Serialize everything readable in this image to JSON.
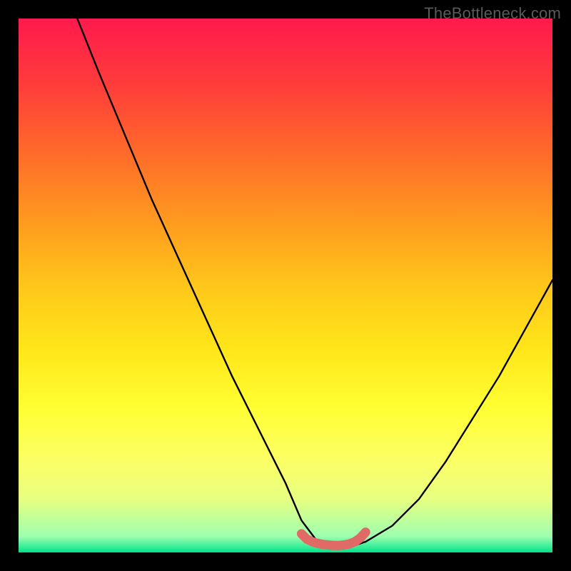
{
  "watermark": "TheBottleneck.com",
  "chart_data": {
    "type": "line",
    "title": "",
    "xlabel": "",
    "ylabel": "",
    "xlim": [
      0,
      100
    ],
    "ylim": [
      0,
      100
    ],
    "series": [
      {
        "name": "bottleneck-curve",
        "x": [
          11,
          15,
          20,
          25,
          30,
          35,
          40,
          45,
          50,
          53,
          56,
          58,
          60,
          62,
          65,
          70,
          75,
          80,
          85,
          90,
          95,
          100
        ],
        "y": [
          100,
          90,
          78,
          66,
          55,
          44,
          33,
          23,
          13,
          6,
          2,
          1,
          1,
          1,
          2,
          5,
          10,
          17,
          25,
          33,
          42,
          51
        ]
      },
      {
        "name": "optimal-zone-marker",
        "x": [
          53,
          54,
          55,
          56,
          57,
          58,
          59,
          60,
          61,
          62,
          63,
          64,
          65
        ],
        "y": [
          3.5,
          2.5,
          2,
          1.7,
          1.5,
          1.4,
          1.3,
          1.3,
          1.4,
          1.6,
          2,
          2.7,
          3.8
        ]
      }
    ],
    "background_gradient": {
      "top": "#ff1a4d",
      "mid": "#ffe61a",
      "bottom": "#00e38a"
    },
    "marker_color": "#e06a65"
  }
}
